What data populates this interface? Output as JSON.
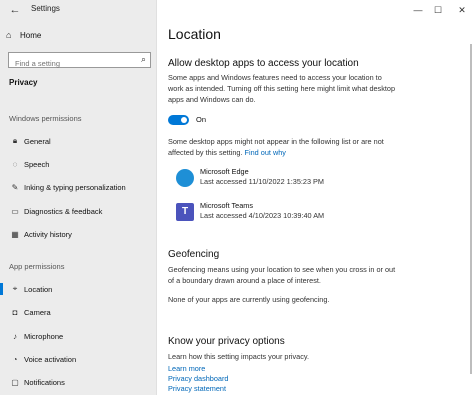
{
  "window": {
    "title": "Settings",
    "back_glyph": "←",
    "controls": {
      "minimize": "—",
      "maximize": "☐",
      "close": "✕"
    }
  },
  "sidebar": {
    "home_label": "Home",
    "search_placeholder": "Find a setting",
    "category": "Privacy",
    "section_windows": "Windows permissions",
    "windows_items": [
      {
        "label": "General",
        "icon": "lock-icon"
      },
      {
        "label": "Speech",
        "icon": "speech-icon"
      },
      {
        "label": "Inking & typing personalization",
        "icon": "pen-icon"
      },
      {
        "label": "Diagnostics & feedback",
        "icon": "feedback-icon"
      },
      {
        "label": "Activity history",
        "icon": "history-icon"
      }
    ],
    "section_app": "App permissions",
    "app_items": [
      {
        "label": "Location",
        "icon": "location-icon",
        "selected": true
      },
      {
        "label": "Camera",
        "icon": "camera-icon"
      },
      {
        "label": "Microphone",
        "icon": "microphone-icon"
      },
      {
        "label": "Voice activation",
        "icon": "voice-icon"
      },
      {
        "label": "Notifications",
        "icon": "notifications-icon"
      }
    ]
  },
  "main": {
    "page_title": "Location",
    "allow_heading": "Allow desktop apps to access your location",
    "allow_desc": "Some apps and Windows features need to access your location to work as intended. Turning off this setting here might limit what desktop apps and Windows can do.",
    "toggle_state": "On",
    "note_text": "Some desktop apps might not appear in the following list or are not affected by this setting.",
    "note_link": "Find out why",
    "apps": [
      {
        "name": "Microsoft Edge",
        "accessed": "Last accessed 11/10/2022 1:35:23 PM",
        "icon": "edge-icon",
        "color": "#1e8fd6"
      },
      {
        "name": "Microsoft Teams",
        "accessed": "Last accessed 4/10/2023 10:39:40 AM",
        "icon": "teams-icon",
        "color": "#4b53bc"
      }
    ],
    "geofencing_heading": "Geofencing",
    "geofencing_desc": "Geofencing means using your location to see when you cross in or out of a boundary drawn around a place of interest.",
    "geofencing_status": "None of your apps are currently using geofencing.",
    "privacy_heading": "Know your privacy options",
    "privacy_desc": "Learn how this setting impacts your privacy.",
    "links": [
      "Learn more",
      "Privacy dashboard",
      "Privacy statement"
    ]
  },
  "colors": {
    "accent": "#0078d7",
    "link": "#0067b8",
    "sidebar_bg": "#ececec"
  }
}
